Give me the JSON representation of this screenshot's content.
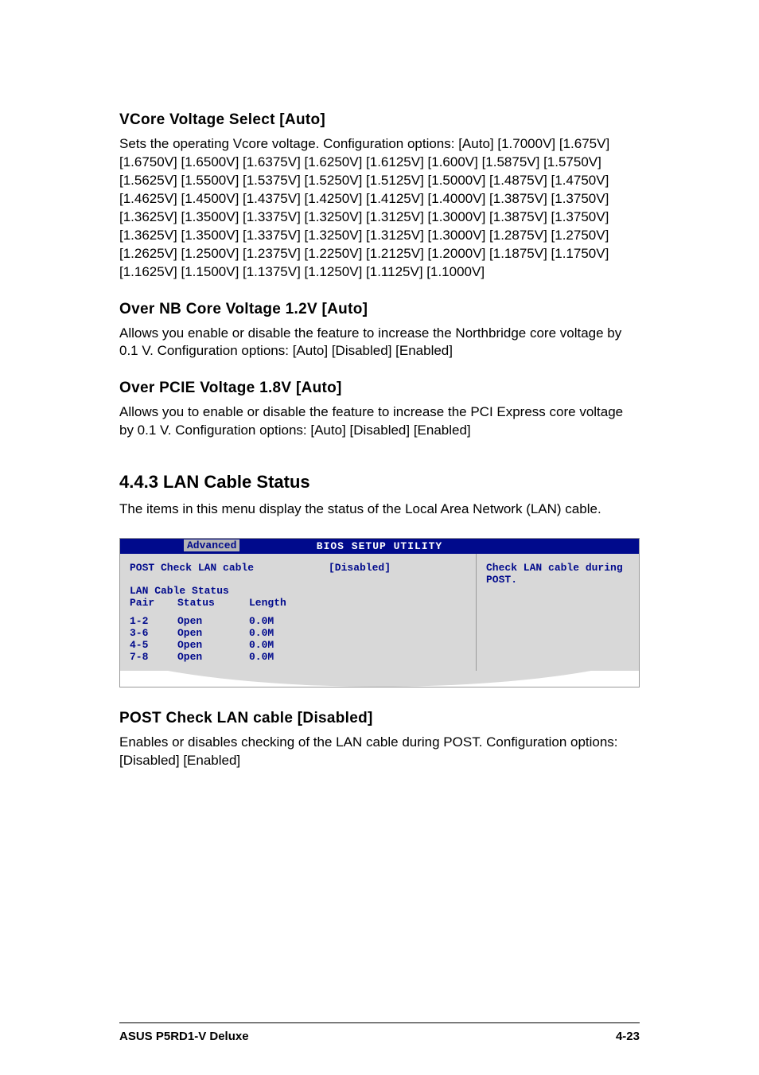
{
  "sections": {
    "vcore": {
      "heading": "VCore Voltage Select [Auto]",
      "text": "Sets the operating Vcore voltage. Configuration options: [Auto] [1.7000V] [1.675V] [1.6750V] [1.6500V] [1.6375V] [1.6250V] [1.6125V] [1.600V] [1.5875V] [1.5750V] [1.5625V] [1.5500V] [1.5375V] [1.5250V] [1.5125V] [1.5000V] [1.4875V] [1.4750V] [1.4625V] [1.4500V] [1.4375V] [1.4250V] [1.4125V] [1.4000V] [1.3875V] [1.3750V] [1.3625V] [1.3500V] [1.3375V] [1.3250V] [1.3125V] [1.3000V] [1.3875V] [1.3750V] [1.3625V] [1.3500V] [1.3375V] [1.3250V] [1.3125V] [1.3000V] [1.2875V] [1.2750V] [1.2625V] [1.2500V] [1.2375V] [1.2250V] [1.2125V] [1.2000V] [1.1875V] [1.1750V] [1.1625V] [1.1500V] [1.1375V] [1.1250V] [1.1125V] [1.1000V]"
    },
    "overnb": {
      "heading": "Over NB Core Voltage 1.2V [Auto]",
      "text": "Allows you enable or disable the feature to increase the Northbridge core voltage by 0.1 V. Configuration options: [Auto] [Disabled] [Enabled]"
    },
    "overpcie": {
      "heading": "Over PCIE Voltage 1.8V [Auto]",
      "text": "Allows you to enable or disable the feature to increase the PCI Express core voltage by 0.1 V. Configuration options: [Auto] [Disabled] [Enabled]"
    },
    "lan": {
      "heading": "4.4.3   LAN Cable Status",
      "text": "The items in this menu display the status of the Local Area Network (LAN) cable."
    },
    "postcheck": {
      "heading": "POST Check LAN cable [Disabled]",
      "text": "Enables or disables checking of the LAN cable during POST. Configuration options: [Disabled] [Enabled]"
    }
  },
  "bios": {
    "title": "BIOS SETUP UTILITY",
    "tab": "Advanced",
    "setting_label": "POST Check LAN cable",
    "setting_value": "[Disabled]",
    "subheading": "LAN Cable Status",
    "table_headers": {
      "pair": "Pair",
      "status": "Status",
      "length": "Length"
    },
    "rows": [
      {
        "pair": "1-2",
        "status": "Open",
        "length": "0.0M"
      },
      {
        "pair": "3-6",
        "status": "Open",
        "length": "0.0M"
      },
      {
        "pair": "4-5",
        "status": "Open",
        "length": "0.0M"
      },
      {
        "pair": "7-8",
        "status": "Open",
        "length": "0.0M"
      }
    ],
    "help": "Check LAN cable during POST."
  },
  "footer": {
    "left": "ASUS P5RD1-V Deluxe",
    "right": "4-23"
  }
}
